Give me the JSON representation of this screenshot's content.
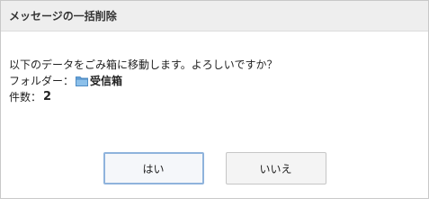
{
  "dialog": {
    "title": "メッセージの一括削除"
  },
  "message": {
    "text": "以下のデータをごみ箱に移動します。よろしいですか？",
    "folder_label": "フォルダー：",
    "folder_icon": "folder-icon",
    "folder_name": "受信箱",
    "count_label": "件数：",
    "count_value": "2"
  },
  "buttons": {
    "yes_label": "はい",
    "no_label": "いいえ"
  },
  "colors": {
    "header_bg": "#eeeeee",
    "folder_icon": "#6aa6dc",
    "primary_border": "#8fb3dc"
  }
}
